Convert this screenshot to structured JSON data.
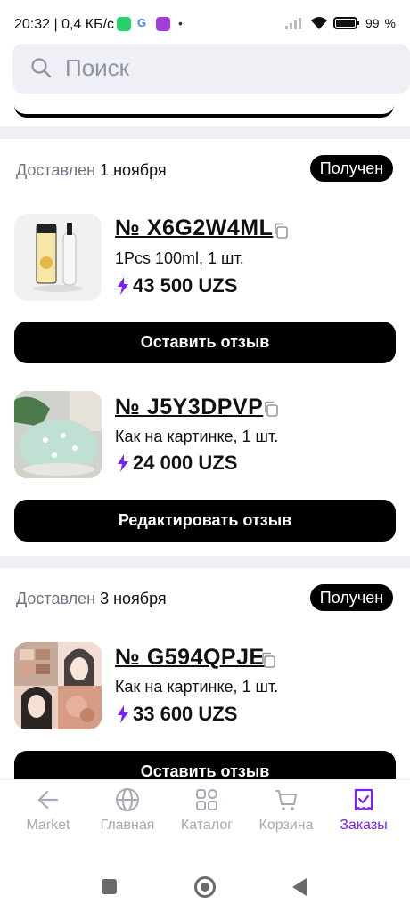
{
  "status_bar": {
    "time_speed": "20:32 | 0,4 КБ/с",
    "battery": "99"
  },
  "search": {
    "placeholder": "Поиск"
  },
  "groups": [
    {
      "delivered_label": "Доставлен",
      "date": "1 ноября",
      "status_badge": "Получен",
      "orders": [
        {
          "number": "№ X6G2W4ML",
          "desc": "1Pcs 100ml, 1 шт.",
          "price": "43 500 UZS",
          "button": "Оставить отзыв"
        },
        {
          "number": "№ J5Y3DPVP",
          "desc": "Как на картинке, 1 шт.",
          "price": "24 000 UZS",
          "button": "Редактировать отзыв"
        }
      ]
    },
    {
      "delivered_label": "Доставлен",
      "date": "3 ноября",
      "status_badge": "Получен",
      "orders": [
        {
          "number": "№ G594QPJE",
          "desc": "Как на картинке, 1 шт.",
          "price": "33 600 UZS",
          "button": "Оставить отзыв"
        }
      ]
    }
  ],
  "bottom_nav": [
    {
      "label": "Market",
      "icon": "arrow-left-icon",
      "active": false
    },
    {
      "label": "Главная",
      "icon": "globe-icon",
      "active": false
    },
    {
      "label": "Каталог",
      "icon": "catalog-grid-icon",
      "active": false
    },
    {
      "label": "Корзина",
      "icon": "cart-icon",
      "active": false
    },
    {
      "label": "Заказы",
      "icon": "orders-receipt-icon",
      "active": true
    }
  ],
  "colors": {
    "accent": "#7a1fff",
    "black": "#000000",
    "muted": "#a6a9b6",
    "divider": "#eef0f4"
  }
}
